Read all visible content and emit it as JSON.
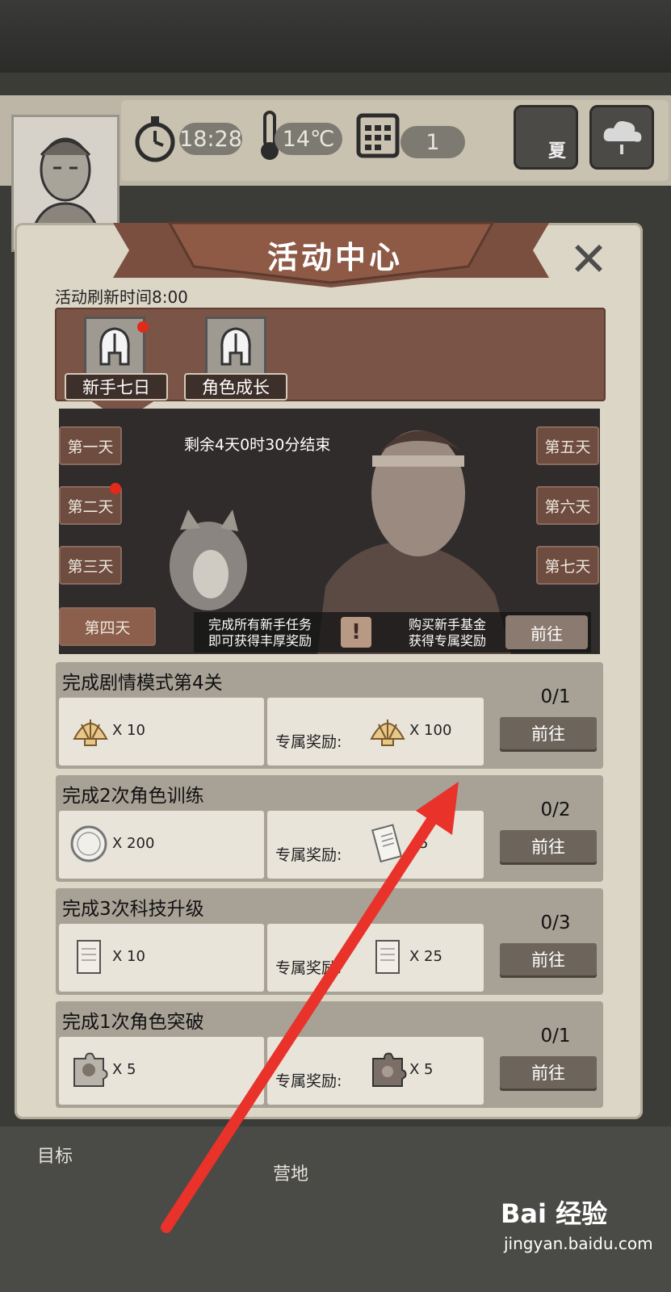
{
  "hud": {
    "time": "18:28",
    "temperature": "14℃",
    "day_count": "1",
    "season_label": "夏"
  },
  "panel": {
    "title": "活动中心",
    "refresh_text": "活动刷新时间8:00",
    "tabs": [
      {
        "label": "新手七日",
        "icon": "helmet-icon",
        "has_dot": true
      },
      {
        "label": "角色成长",
        "icon": "helmet-icon",
        "has_dot": false
      }
    ],
    "days": [
      "第一天",
      "第二天",
      "第三天",
      "第四天",
      "第五天",
      "第六天",
      "第七天"
    ],
    "remaining": "剩余4天0时30分结束",
    "banner_left_line1": "完成所有新手任务",
    "banner_left_line2": "即可获得丰厚奖励",
    "banner_right_line1": "购买新手基金",
    "banner_right_line2": "获得专属奖励",
    "banner_goto": "前往"
  },
  "tasks": [
    {
      "title": "完成剧情模式第4关",
      "reward_qty": "X 10",
      "reward_icon": "shell-icon",
      "excl_label": "专属奖励:",
      "excl_qty": "X 100",
      "excl_icon": "shell-icon",
      "progress": "0/1",
      "goto": "前往"
    },
    {
      "title": "完成2次角色训练",
      "reward_qty": "X 200",
      "reward_icon": "coin-icon",
      "excl_label": "专属奖励:",
      "excl_qty": "5",
      "excl_icon": "scroll-icon",
      "progress": "0/2",
      "goto": "前往"
    },
    {
      "title": "完成3次科技升级",
      "reward_qty": "X 10",
      "reward_icon": "paper-icon",
      "excl_label": "专属奖",
      "excl_label_tail": "励:",
      "excl_qty": "X 25",
      "excl_icon": "paper-icon",
      "progress": "0/3",
      "goto": "前往"
    },
    {
      "title": "完成1次角色突破",
      "reward_qty": "X 5",
      "reward_icon": "portrait-puzzle-icon",
      "excl_label": "专属奖励:",
      "excl_qty": "X 5",
      "excl_icon": "puzzle-icon",
      "progress": "0/1",
      "goto": "前往"
    }
  ],
  "bottom": {
    "target_label": "目标",
    "camp_label": "营地"
  },
  "watermark": {
    "brand": "Bai 经验",
    "url": "jingyan.baidu.com"
  },
  "colors": {
    "panel_bg": "#dcd6c7",
    "tab_strip": "#7a5446",
    "day_tab": "#6e4c3f",
    "goto_btn": "#6d655c",
    "arrow": "#e8322a"
  }
}
